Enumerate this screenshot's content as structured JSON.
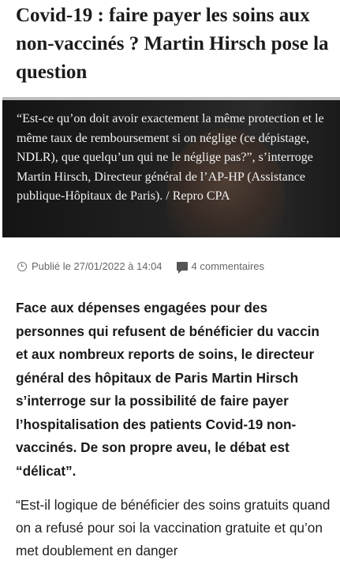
{
  "article": {
    "title": "Covid-19 : faire payer les soins aux non-vaccinés ? Martin Hirsch pose la question",
    "image_caption": "“Est-ce qu’on doit avoir exactement la même protection et le même taux de remboursement si on néglige (ce dépistage, NDLR), que quelqu’un qui ne le néglige pas?”, s’interroge Martin Hirsch, Directeur général de l’AP-HP (Assistance publique-Hôpitaux de Paris).  / Repro CPA",
    "published": "Publié le 27/01/2022 à 14:04",
    "comments": "4 commentaires",
    "lede": "Face aux dépenses engagées pour des personnes qui refusent de bénéficier du vaccin et aux nombreux reports de soins, le directeur général des hôpitaux de Paris Martin Hirsch s’interroge sur la possibilité de faire payer l’hospitalisation des patients Covid-19 non-vaccinés. De son propre aveu, le débat est “délicat”.",
    "paragraph": "“Est-il logique de bénéficier des soins gratuits quand on a refusé pour soi la vaccination gratuite et qu’on met doublement en danger"
  },
  "icons": {
    "published": "clock-icon",
    "comments": "comment-icon"
  }
}
